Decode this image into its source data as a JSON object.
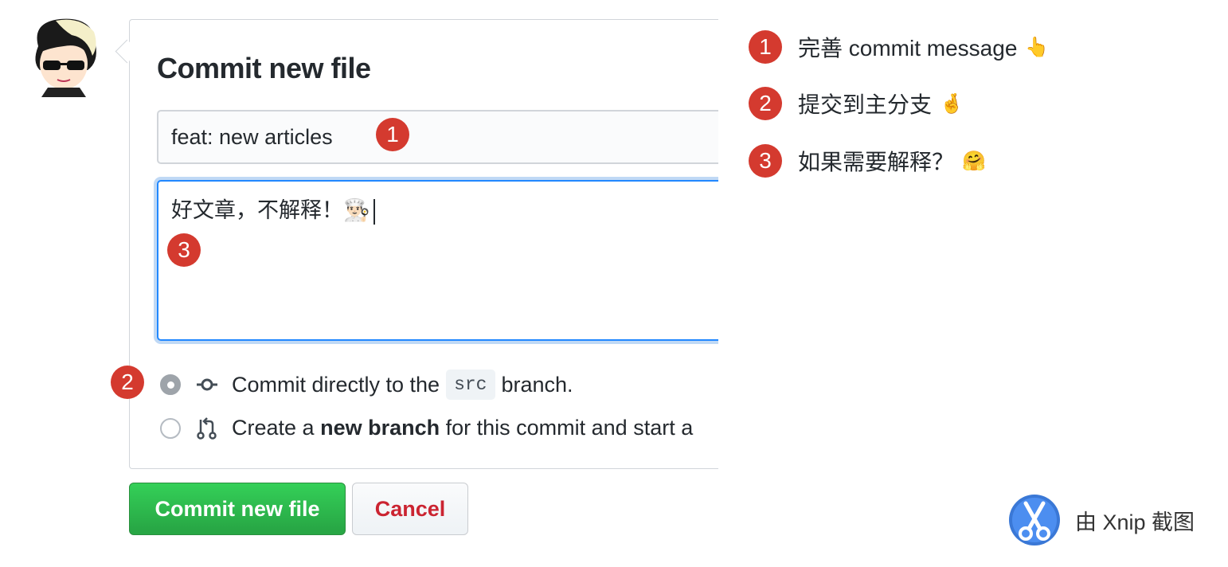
{
  "commit_form": {
    "title": "Commit new file",
    "summary_value": "feat: new articles",
    "description_value": "好文章，不解释！👨🏻‍🍳",
    "options": {
      "direct": {
        "prefix": "Commit directly to the",
        "branch": "src",
        "suffix": "branch.",
        "selected": true
      },
      "new_branch": {
        "prefix": "Create a",
        "bold": "new branch",
        "suffix": "for this commit and start a",
        "selected": false
      }
    },
    "commit_button": "Commit new file",
    "cancel_button": "Cancel"
  },
  "markers": {
    "one": "1",
    "two": "2",
    "three": "3"
  },
  "notes": [
    {
      "num": "1",
      "text": "完善 commit message",
      "emoji": "👆"
    },
    {
      "num": "2",
      "text": "提交到主分支",
      "emoji": "🤞"
    },
    {
      "num": "3",
      "text": "如果需要解释？",
      "emoji": "🤗"
    }
  ],
  "watermark": {
    "text": "由 Xnip 截图",
    "icon": "scissors-icon"
  },
  "colors": {
    "badge": "#d43a2f",
    "commit_green": "#28a745",
    "cancel_red": "#cb2431",
    "focus_blue": "#2188ff"
  }
}
